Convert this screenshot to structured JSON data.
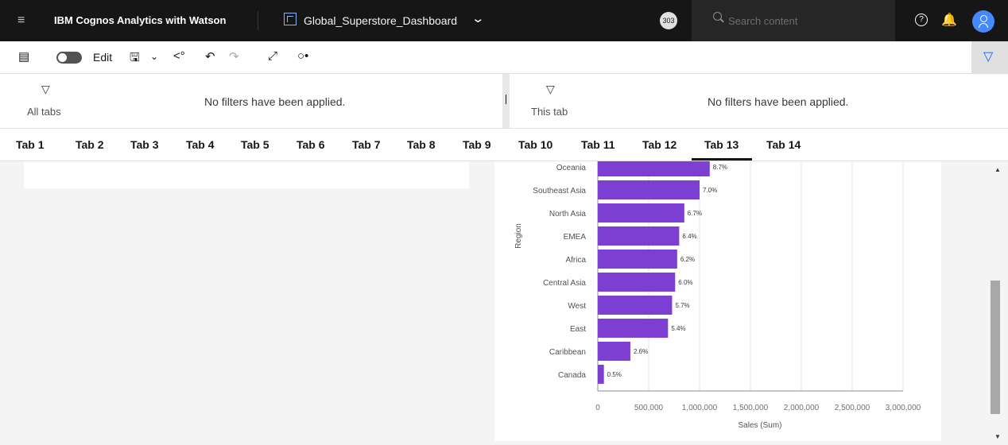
{
  "topbar": {
    "product_bold": "IBM Cognos Analytics with Watson",
    "dashboard_name": "Global_Superstore_Dashboard",
    "badge": "303",
    "search_placeholder": "Search content",
    "icons": [
      "menu-icon",
      "dashboard-icon",
      "chevron-down-icon",
      "search-icon",
      "help-icon",
      "notification-bell-icon",
      "user-avatar-icon"
    ]
  },
  "toolbar": {
    "edit_label": "Edit",
    "icons": [
      "comment-icon",
      "edit-toggle",
      "save-icon",
      "chevron-down-icon",
      "share-icon",
      "undo-icon",
      "redo-icon",
      "fullscreen-icon",
      "pin-icon",
      "filter-icon"
    ]
  },
  "filters": {
    "all_tabs": {
      "label": "All tabs",
      "message": "No filters have been applied."
    },
    "this_tab": {
      "label": "This tab",
      "message": "No filters have been applied."
    }
  },
  "tabs": [
    "Tab 1",
    "Tab 2",
    "Tab 3",
    "Tab 4",
    "Tab 5",
    "Tab 6",
    "Tab 7",
    "Tab 8",
    "Tab 9",
    "Tab 10",
    "Tab 11",
    "Tab 12",
    "Tab 13",
    "Tab 14"
  ],
  "active_tab": "Tab 13",
  "chart_data": {
    "type": "bar",
    "orientation": "horizontal",
    "categories": [
      "Oceania",
      "Southeast Asia",
      "North Asia",
      "EMEA",
      "Africa",
      "Central Asia",
      "West",
      "East",
      "Caribbean",
      "Canada"
    ],
    "values": [
      1100000,
      1000000,
      850000,
      800000,
      780000,
      760000,
      730000,
      690000,
      320000,
      60000
    ],
    "data_labels": [
      "8.7%",
      "7.0%",
      "6.7%",
      "6.4%",
      "6.2%",
      "6.0%",
      "5.7%",
      "5.4%",
      "2.6%",
      "0.5%"
    ],
    "ylabel": "Region",
    "xlabel": "Sales (Sum)",
    "xticks": [
      "0",
      "500,000",
      "1,000,000",
      "1,500,000",
      "2,000,000",
      "2,500,000",
      "3,000,000"
    ],
    "xlim": [
      0,
      3000000
    ],
    "bar_color": "#7d3fd1",
    "grid": true
  }
}
